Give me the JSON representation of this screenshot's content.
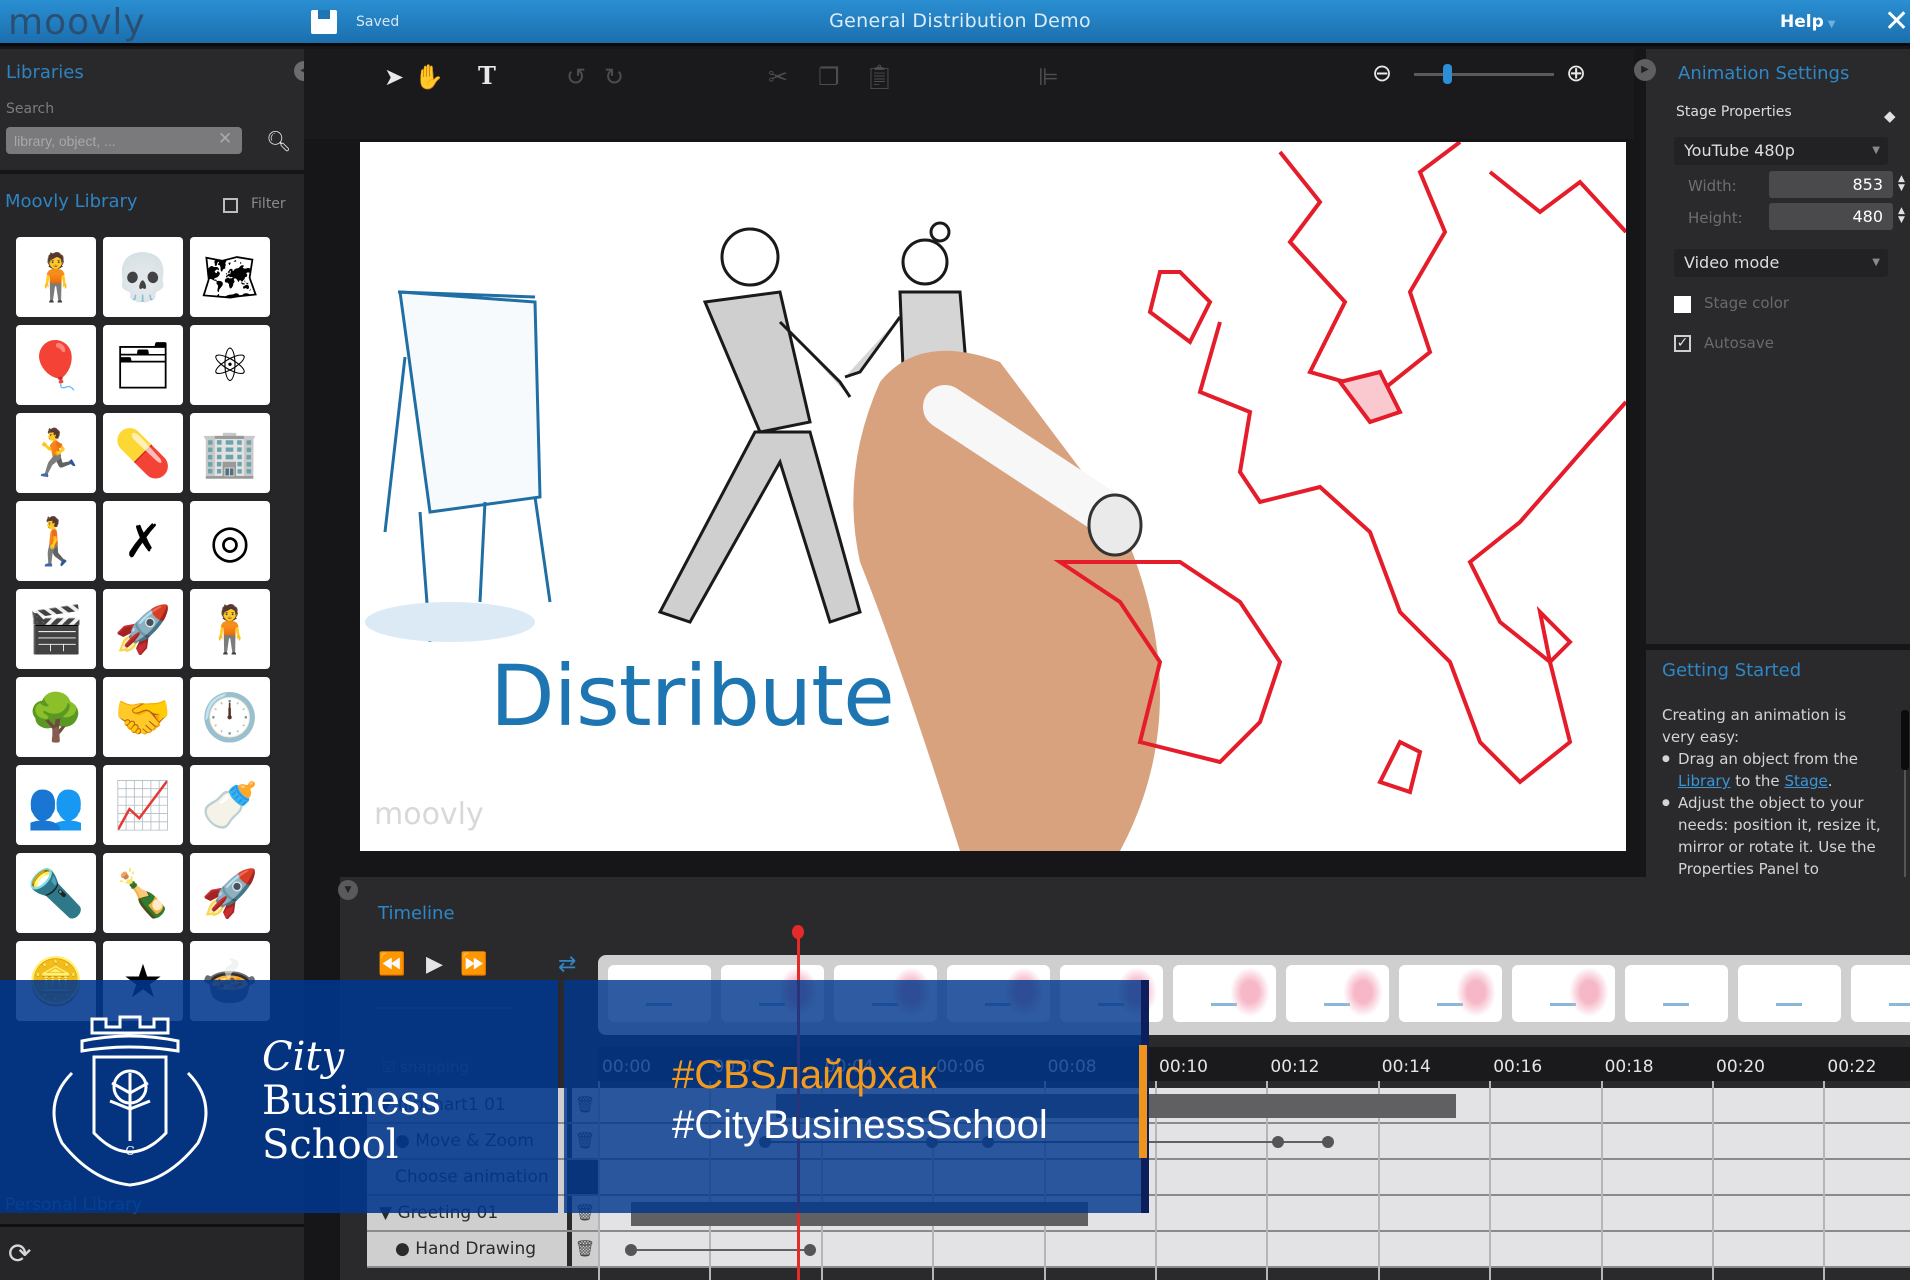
{
  "app": {
    "logo": "moovly",
    "save_status": "Saved",
    "document_title": "General Distribution Demo",
    "help_label": "Help",
    "close_icon": "close-icon"
  },
  "libraries": {
    "title": "Libraries",
    "search_label": "Search",
    "search_placeholder": "library, object, ...",
    "search_value": "",
    "moovly_library_title": "Moovly Library",
    "filter_label": "Filter",
    "filter_checked": false,
    "items": [
      {
        "name": "businessman",
        "glyph": "🧍"
      },
      {
        "name": "blue-skeleton",
        "glyph": "💀"
      },
      {
        "name": "italy-map",
        "glyph": "🗺"
      },
      {
        "name": "balloon",
        "glyph": "🎈"
      },
      {
        "name": "banner-stand",
        "glyph": "🗂"
      },
      {
        "name": "atomium",
        "glyph": "⚛"
      },
      {
        "name": "running-boy",
        "glyph": "🏃"
      },
      {
        "name": "pill",
        "glyph": "💊"
      },
      {
        "name": "buildings",
        "glyph": "🏢"
      },
      {
        "name": "boy-with-cart",
        "glyph": "🚶"
      },
      {
        "name": "red-cross",
        "glyph": "✗"
      },
      {
        "name": "bicycle-wheel",
        "glyph": "◎"
      },
      {
        "name": "clapperboard",
        "glyph": "🎬"
      },
      {
        "name": "rocket-trail",
        "glyph": "🚀"
      },
      {
        "name": "standing-man",
        "glyph": "🧍"
      },
      {
        "name": "park-scene",
        "glyph": "🌳"
      },
      {
        "name": "handshake-people",
        "glyph": "🤝"
      },
      {
        "name": "clock",
        "glyph": "🕛"
      },
      {
        "name": "crowd-sketch",
        "glyph": "👥"
      },
      {
        "name": "growth-chart",
        "glyph": "📈"
      },
      {
        "name": "milk-bottle",
        "glyph": "🍼"
      },
      {
        "name": "spotlight",
        "glyph": "🔦"
      },
      {
        "name": "wine-bottle",
        "glyph": "🍾"
      },
      {
        "name": "blue-rocket",
        "glyph": "🚀"
      },
      {
        "name": "coin-stack",
        "glyph": "🪙"
      },
      {
        "name": "blue-star",
        "glyph": "★"
      },
      {
        "name": "cooking-pot",
        "glyph": "🍲"
      }
    ],
    "personal_library_title": "Personal Library"
  },
  "toolbar": {
    "tools": [
      "select-arrow",
      "hand-pan",
      "text-tool",
      "undo",
      "redo",
      "cut",
      "copy",
      "paste",
      "align"
    ],
    "zoom_level_fraction": 0.22
  },
  "stage": {
    "caption": "Distribute",
    "watermark": "moovly"
  },
  "animation_settings": {
    "title": "Animation Settings",
    "stage_properties_label": "Stage Properties",
    "preset": "YouTube 480p",
    "width_label": "Width:",
    "width_value": "853",
    "height_label": "Height:",
    "height_value": "480",
    "mode": "Video mode",
    "stage_color_label": "Stage color",
    "stage_color_checked": false,
    "autosave_label": "Autosave",
    "autosave_checked": true
  },
  "getting_started": {
    "title": "Getting Started",
    "intro": "Creating an animation is very easy:",
    "step1_pre": "Drag an object from the ",
    "step1_link1": "Library",
    "step1_mid": " to the ",
    "step1_link2": "Stage",
    "step1_post": ".",
    "step2": "Adjust the object to your needs: position it, resize it, mirror or rotate it. Use the Properties Panel to"
  },
  "timeline": {
    "title": "Timeline",
    "snapping_label": "snapping",
    "snapping_checked": true,
    "playhead_time": "00:03.5",
    "ticks": [
      "00:00",
      "00:02",
      "00:04",
      "00:06",
      "00:08",
      "00:10",
      "00:12",
      "00:14",
      "00:16",
      "00:18",
      "00:20",
      "00:22"
    ],
    "rows": [
      {
        "label": "flipchart1 01",
        "type": "object",
        "bar": [
          3.2,
          15.4
        ]
      },
      {
        "label": "Move & Zoom",
        "type": "animation",
        "keyframes": [
          3.0,
          6.0,
          7.0,
          12.2,
          13.1
        ]
      },
      {
        "label": "Choose animation",
        "type": "placeholder"
      },
      {
        "label": "Greeting 01",
        "type": "object",
        "bar": [
          0.6,
          8.8
        ]
      },
      {
        "label": "Hand Drawing",
        "type": "animation",
        "keyframes": [
          0.6,
          3.8
        ]
      }
    ],
    "thumbnails": 12
  },
  "branding": {
    "school_line1": "City",
    "school_line2": "Business",
    "school_line3": "School",
    "crest_letter": "C",
    "hashtag_primary": "#CBSлайфхак",
    "hashtag_secondary": "#CityBusinessSchool",
    "accent_color": "#f39a1e",
    "brand_blue": "#00378c"
  }
}
